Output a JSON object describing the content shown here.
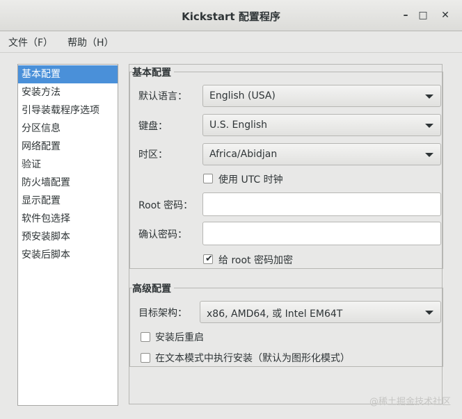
{
  "window": {
    "title": "Kickstart 配置程序"
  },
  "window_controls": {
    "minimize": "–",
    "maximize": "□",
    "close": "✕"
  },
  "menubar": {
    "items": [
      "文件（F）",
      "帮助（H）"
    ]
  },
  "sidebar": {
    "items": [
      "基本配置",
      "安装方法",
      "引导装载程序选项",
      "分区信息",
      "网络配置",
      "验证",
      "防火墙配置",
      "显示配置",
      "软件包选择",
      "预安装脚本",
      "安装后脚本"
    ],
    "selected": "基本配置"
  },
  "basic": {
    "title": "基本配置",
    "language_label": "默认语言：",
    "language_value": "English (USA)",
    "keyboard_label": "键盘：",
    "keyboard_value": "U.S. English",
    "timezone_label": "时区：",
    "timezone_value": "Africa/Abidjan",
    "utc_label": "使用  UTC 时钟",
    "utc_checked": false,
    "root_password_label": "Root 密码：",
    "root_password_value": "",
    "confirm_password_label": "确认密码：",
    "confirm_password_value": "",
    "encrypt_label": "给  root 密码加密",
    "encrypt_checked": true
  },
  "advanced": {
    "title": "高级配置",
    "arch_label": "目标架构：",
    "arch_value": "x86, AMD64, 或  Intel EM64T",
    "reboot_label": "安装后重启",
    "reboot_checked": false,
    "textmode_label": "在文本模式中执行安装（默认为图形化模式）",
    "textmode_checked": false
  },
  "watermark": "@稀土掘金技术社区"
}
